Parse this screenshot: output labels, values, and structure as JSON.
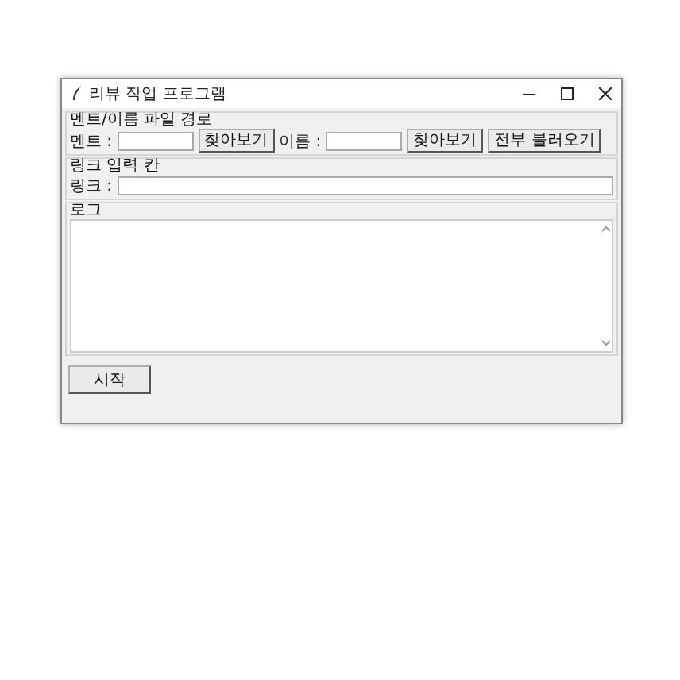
{
  "window": {
    "title": "리뷰 작업 프로그램"
  },
  "file_paths": {
    "label": "멘트/이름 파일 경로",
    "ment_label": "멘트 :",
    "ment_browse": "찾아보기",
    "name_label": "이름 :",
    "name_browse": "찾아보기",
    "load_all": "전부 불러오기"
  },
  "link_input": {
    "label": "링크 입력 칸",
    "link_label": "링크 :"
  },
  "log": {
    "label": "로그"
  },
  "start_button": "시작"
}
